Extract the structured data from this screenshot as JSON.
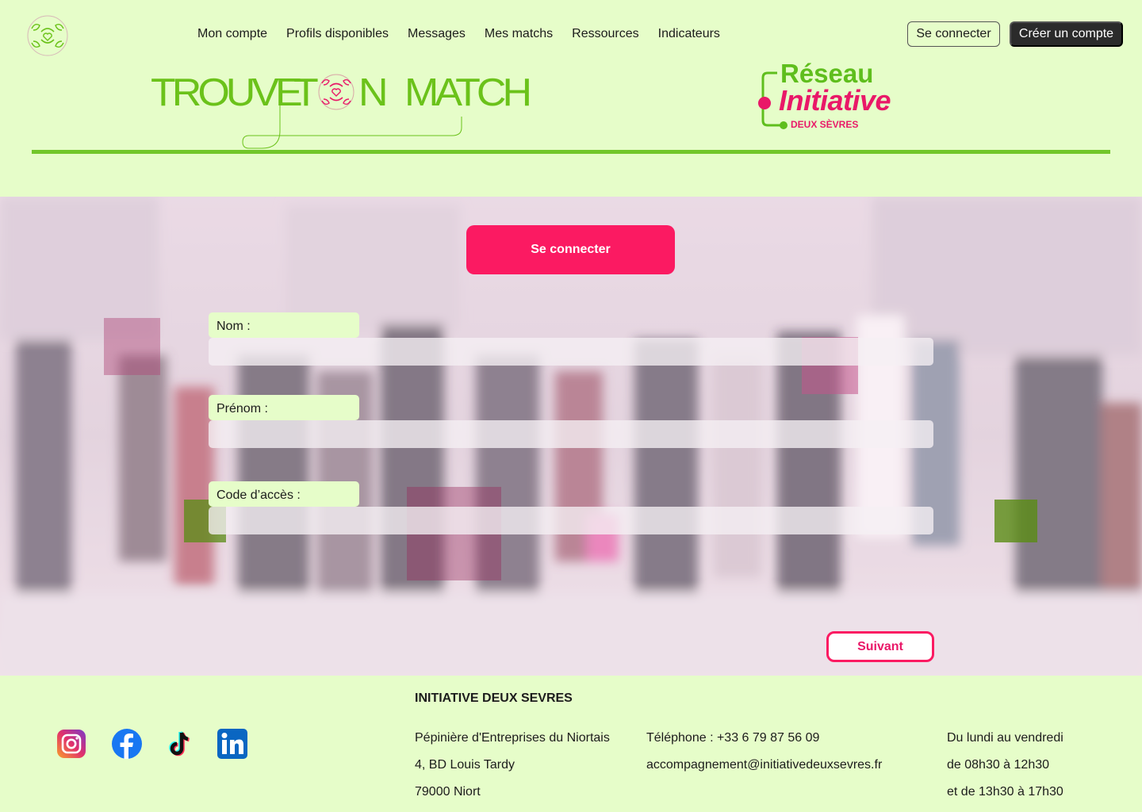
{
  "colors": {
    "background": "#e6fdc9",
    "accent_green": "#6bc21a",
    "accent_pink": "#fb1a62",
    "dark_button": "#2b2b2b"
  },
  "header": {
    "nav": [
      "Mon compte",
      "Profils disponibles",
      "Messages",
      "Mes matchs",
      "Ressources",
      "Indicateurs"
    ],
    "login_label": "Se connecter",
    "create_account_label": "Créer un compte",
    "brand_words": [
      "TROUVE",
      "T",
      "N",
      "MATCH"
    ],
    "partner": {
      "line1": "Réseau",
      "line2": "Initiative",
      "line3": "DEUX SÈVRES"
    }
  },
  "form": {
    "title": "Se connecter",
    "fields": [
      {
        "label": "Nom :",
        "value": ""
      },
      {
        "label": "Prénom :",
        "value": ""
      },
      {
        "label": "Code d’accès :",
        "value": ""
      }
    ],
    "next_label": "Suivant"
  },
  "footer": {
    "org_name": "INITIATIVE DEUX SEVRES",
    "social_icons": [
      "instagram-icon",
      "facebook-icon",
      "tiktok-icon",
      "linkedin-icon"
    ],
    "address": [
      "Pépinière d'Entreprises du Niortais",
      "4, BD Louis Tardy",
      "79000 Niort"
    ],
    "contact": [
      "Téléphone : +33 6 79 87 56 09",
      "accompagnement@initiativedeuxsevres.fr"
    ],
    "hours": [
      "Du lundi au vendredi",
      "de 08h30 à 12h30",
      "et de 13h30 à 17h30"
    ]
  }
}
